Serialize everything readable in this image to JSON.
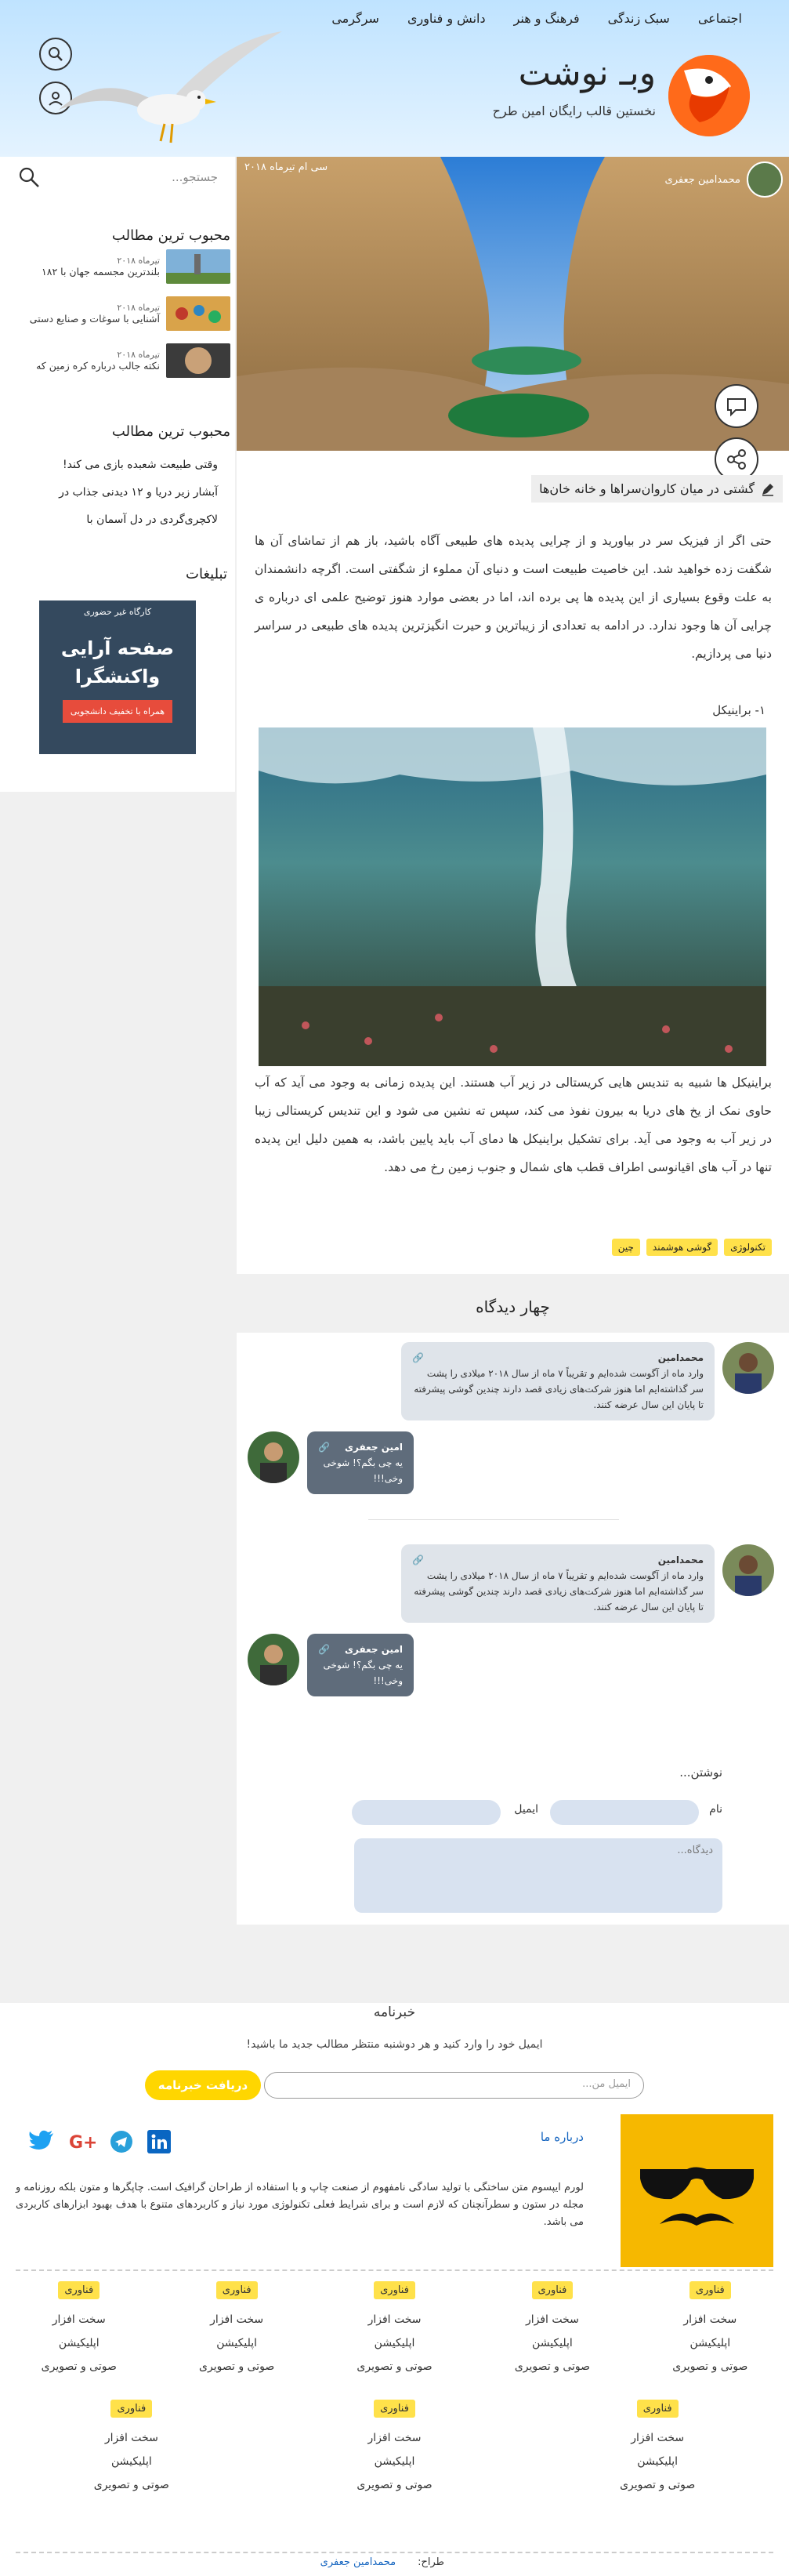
{
  "header": {
    "nav": [
      "اجتماعی",
      "سبک زندگی",
      "فرهنگ و هنر",
      "دانش و فناوری",
      "سرگرمی"
    ],
    "site_title": "وبـ نوشت",
    "site_subtitle": "نخستین قالب رایگان امین طرح"
  },
  "sidebar": {
    "search_placeholder": "جستجو...",
    "popular_title": "محبوب ترین مطالب",
    "popular_posts": [
      {
        "date": "تیرماه ۲۰۱۸",
        "text": "بلندترین مجسمه جهان با ۱۸۲"
      },
      {
        "date": "تیرماه ۲۰۱۸",
        "text": "آشنایی با سوغات و صنایع دستی"
      },
      {
        "date": "تیرماه ۲۰۱۸",
        "text": "نکته جالب درباره کره زمین که"
      }
    ],
    "popular_title2": "محبوب ترین مطالب",
    "popular_links": [
      "وقتی طبیعت شعبده بازی می کند!",
      "آبشار زیر دریا و ۱۲ دیدنی جذاب در",
      "لاکچری‌گردی در دل آسمان با"
    ],
    "ads_title": "تبلیغات",
    "ad": {
      "top": "کارگاه غیر حضوری",
      "line1": "صفحه آرایی",
      "line2": "واکنشگرا",
      "button": "همراه با تخفیف دانشجویی"
    }
  },
  "post": {
    "author": "محمدامین جعفری",
    "date": "سی ام تیرماه ۲۰۱۸",
    "title": "گشتی در میان کاروان‌سراها و خانه خان‌ها",
    "intro": "حتی اگر از فیزیک سر در بیاورید و از چرایی پدیده های طبیعی آگاه باشید، باز هم از تماشای آن ها شگفت زده خواهید شد. این خاصیت طبیعت است و دنیای آن مملوء از شگفتی است. اگرچه دانشمندان به علت وقوع بسیاری از این پدیده ها پی برده اند، اما در بعضی موارد هنوز توضیح علمی ای درباره ی چرایی آن ها وجود ندارد. در ادامه به تعدادی از زیباترین و حیرت انگیزترین پدیده های طبیعی در سراسر دنیا می پردازیم.",
    "section_heading": "۱- براینیکل",
    "body": "براینیکل ها شبیه به تندیس هایی کریستالی در زیر آب هستند. این پدیده زمانی به وجود می آید که آب حاوی نمک از یخ های دریا به بیرون نفوذ می کند، سپس ته نشین می شود و این تندیس کریستالی زیبا در زیر آب به وجود می آید. برای تشکیل براینیکل ها دمای آب باید پایین باشد، به همین دلیل این پدیده تنها در آب های اقیانوسی اطراف قطب های شمال و جنوب زمین رخ می دهد.",
    "tags": [
      "تکنولوژی",
      "گوشی هوشمند",
      "چین"
    ]
  },
  "comments": {
    "title": "چهار دیدگاه",
    "items": [
      {
        "name": "محمدامین",
        "text": "وارد ماه از آگوست شده‌ایم و تقریباً ۷ ماه از سال ۲۰۱۸ میلادی را پشت سر گذاشته‌ایم اما هنوز شرکت‌های زیادی قصد دارند چندین گوشی پیشرفته تا پایان این سال عرضه کنند."
      },
      {
        "name": "امین جعفری",
        "text": "یه چی بگم؟! شوخی وخی!!!"
      },
      {
        "name": "محمدامین",
        "text": "وارد ماه از آگوست شده‌ایم و تقریباً ۷ ماه از سال ۲۰۱۸ میلادی را پشت سر گذاشته‌ایم اما هنوز شرکت‌های زیادی قصد دارند چندین گوشی پیشرفته تا پایان این سال عرضه کنند."
      },
      {
        "name": "امین جعفری",
        "text": "یه چی بگم؟! شوخی وخی!!!"
      }
    ],
    "form": {
      "title": "نوشتن...",
      "name_label": "نام",
      "email_label": "ایمیل",
      "textarea_placeholder": "دیدگاه..."
    }
  },
  "newsletter": {
    "title": "خبرنامه",
    "desc": "ایمیل خود را وارد کنید و هر دوشنبه منتظر مطالب جدید ما باشید!",
    "placeholder": "ایمیل من...",
    "button": "دریافت خبرنامه"
  },
  "footer": {
    "about_title": "درباره ما",
    "about_text": "لورم ایپسوم متن ساختگی با تولید سادگی نامفهوم از صنعت چاپ و با استفاده از طراحان گرافیک است. چاپگرها و متون بلکه روزنامه و مجله در ستون و سطرآنچنان که لازم است و برای شرایط فعلی تکنولوژی مورد نیاز و کاربردهای متنوع با هدف بهبود ابزارهای کاربردی می باشد.",
    "columns": [
      {
        "tag": "فناوری",
        "links": [
          "سخت افزار",
          "اپلیکیشن",
          "صوتی و تصویری"
        ]
      },
      {
        "tag": "فناوری",
        "links": [
          "سخت افزار",
          "اپلیکیشن",
          "صوتی و تصویری"
        ]
      },
      {
        "tag": "فناوری",
        "links": [
          "سخت افزار",
          "اپلیکیشن",
          "صوتی و تصویری"
        ]
      },
      {
        "tag": "فناوری",
        "links": [
          "سخت افزار",
          "اپلیکیشن",
          "صوتی و تصویری"
        ]
      },
      {
        "tag": "فناوری",
        "links": [
          "سخت افزار",
          "اپلیکیشن",
          "صوتی و تصویری"
        ]
      },
      {
        "tag": "فناوری",
        "links": [
          "سخت افزار",
          "اپلیکیشن",
          "صوتی و تصویری"
        ]
      },
      {
        "tag": "فناوری",
        "links": [
          "سخت افزار",
          "اپلیکیشن",
          "صوتی و تصویری"
        ]
      },
      {
        "tag": "فناوری",
        "links": [
          "سخت افزار",
          "اپلیکیشن",
          "صوتی و تصویری"
        ]
      }
    ],
    "credit_label": "طراح:",
    "credit_name": "محمدامین جعفری"
  }
}
